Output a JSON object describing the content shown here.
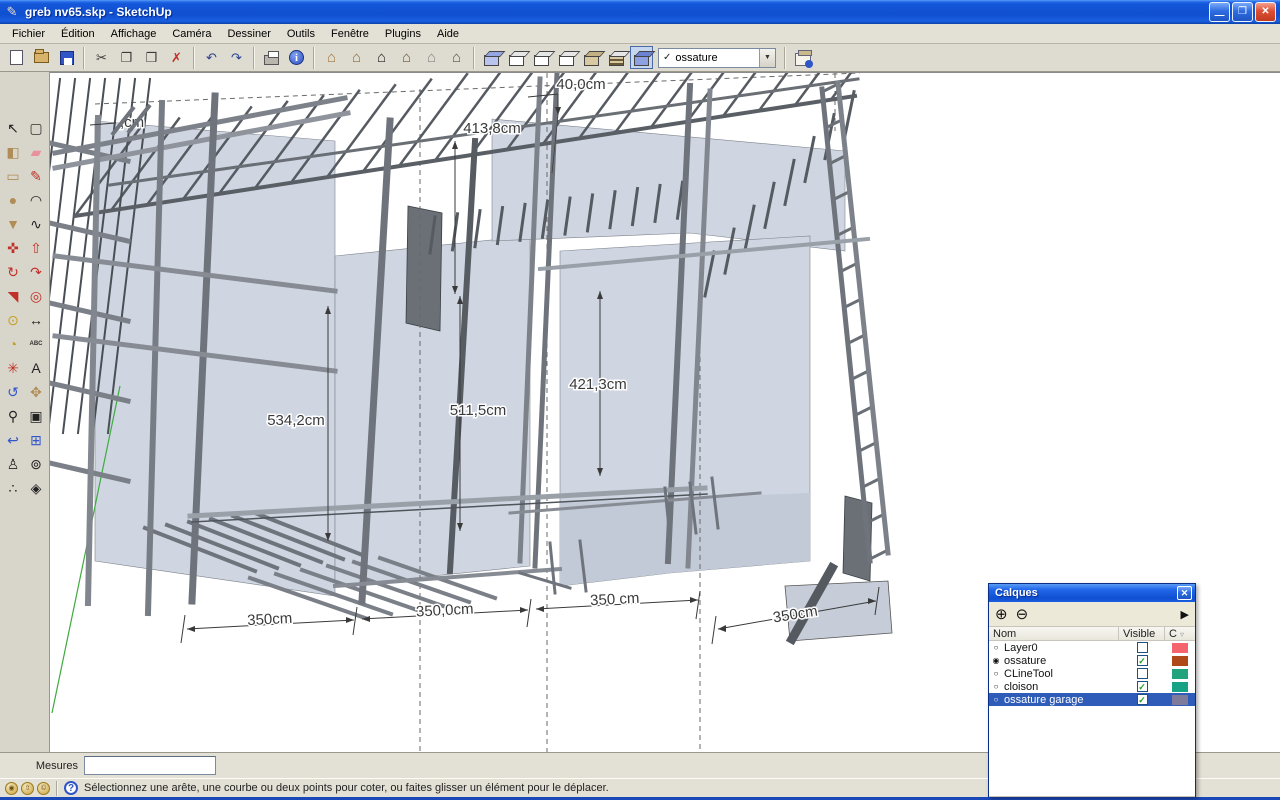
{
  "window": {
    "title": "greb nv65.skp - SketchUp"
  },
  "menu": {
    "items": [
      "Fichier",
      "Édition",
      "Affichage",
      "Caméra",
      "Dessiner",
      "Outils",
      "Fenêtre",
      "Plugins",
      "Aide"
    ]
  },
  "toolbar": {
    "combo": {
      "value": "ossature"
    }
  },
  "icons": {
    "check": "✓",
    "dropdown": "▼",
    "cut": "✂",
    "copy": "❐",
    "paste": "❒",
    "erase": "✗",
    "undo": "↶",
    "redo": "↷",
    "house": "⌂",
    "select": "↖",
    "component": "▢",
    "paint": "◧",
    "eraser": "▰",
    "rectangle": "▭",
    "line": "✎",
    "circle": "●",
    "arc": "◠",
    "polygon": "▼",
    "freehand": "∿",
    "move": "✜",
    "pushpull": "⇧",
    "rotate": "↻",
    "followme": "↷",
    "scale": "◥",
    "offset": "◎",
    "tape": "⊙",
    "dimension": "↔",
    "protractor": "◔",
    "text": "ABC",
    "axes": "✳",
    "text3d": "A",
    "orbit": "↺",
    "pan": "✥",
    "zoom": "⚲",
    "zoomwin": "▣",
    "zoomprev": "↩",
    "zoomext": "⊞",
    "camera": "♙",
    "look": "⊚",
    "walk": "∴",
    "section": "◈",
    "add": "⊕",
    "remove": "⊖",
    "details": "▶",
    "sort": "▿",
    "minimize": "—",
    "restore": "❐",
    "close": "✕",
    "help": "?",
    "status": [
      "◉",
      "⇧",
      "©"
    ]
  },
  "viewport": {
    "dimensions": {
      "d40": "40,0cm",
      "d413": "413,8cm",
      "d511": "511,5cm",
      "d534": "534,2cm",
      "d421": "421,3cm",
      "b1": "350cm",
      "b2": "350,0cm",
      "b3": "350 cm",
      "b4": "350cm",
      "partial": ",cm"
    }
  },
  "layers_panel": {
    "title": "Calques",
    "columns": [
      "Nom",
      "Visible",
      "C"
    ],
    "rows": [
      {
        "name": "Layer0",
        "radio": "○",
        "check": "",
        "visible": false,
        "color": "#f4646c",
        "selected": false
      },
      {
        "name": "ossature",
        "radio": "◉",
        "check": "✓",
        "visible": true,
        "color": "#b0491a",
        "selected": false
      },
      {
        "name": "CLineTool",
        "radio": "○",
        "check": "",
        "visible": false,
        "color": "#21a47e",
        "selected": false
      },
      {
        "name": "cloison",
        "radio": "○",
        "check": "✓",
        "visible": true,
        "color": "#16a285",
        "selected": false
      },
      {
        "name": "ossature garage",
        "radio": "○",
        "check": "✓",
        "visible": true,
        "color": "#7d7a9c",
        "selected": true
      }
    ]
  },
  "measurements": {
    "label": "Mesures",
    "value": ""
  },
  "status": {
    "message": "Sélectionnez une arête, une courbe ou deux points pour coter, ou faites glisser un élément pour le déplacer."
  },
  "colors": {
    "selection": "#2e5cb8",
    "titlebar": "#0f4fd0",
    "panel_fill": "#cfd6e2",
    "axis_green": "#3faa3f"
  }
}
